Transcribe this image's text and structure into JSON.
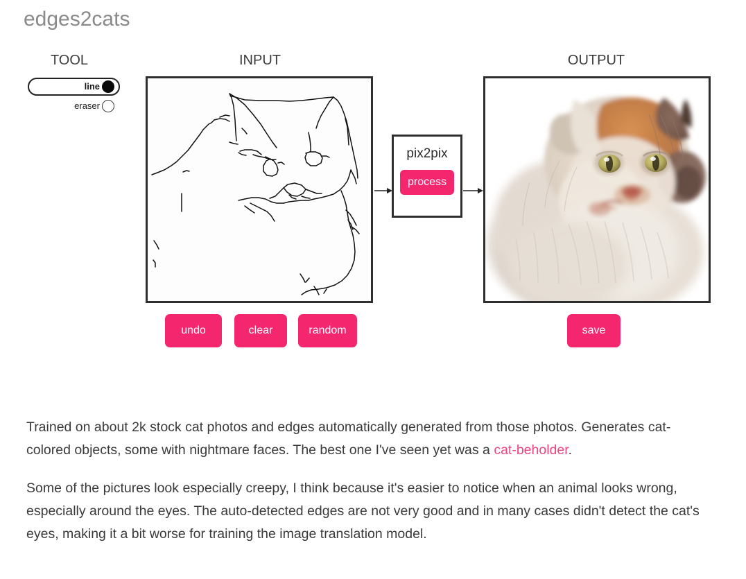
{
  "page": {
    "title": "edges2cats",
    "title_color": "#8a8a8a",
    "accent_color": "#f4266d",
    "link_color": "#f0447f"
  },
  "headers": {
    "tool": "TOOL",
    "input": "INPUT",
    "output": "OUTPUT"
  },
  "tool_panel": {
    "options": [
      {
        "label": "line",
        "selected": true
      },
      {
        "label": "eraser",
        "selected": false
      }
    ],
    "selected_value": "line"
  },
  "pix2pix": {
    "label": "pix2pix",
    "process_label": "process"
  },
  "input_panel": {
    "buttons": [
      {
        "id": "undo",
        "label": "undo"
      },
      {
        "id": "clear",
        "label": "clear"
      },
      {
        "id": "random",
        "label": "random"
      }
    ],
    "canvas_description": "hand-drawn black edge outline of a cat face on white background"
  },
  "output_panel": {
    "buttons": [
      {
        "id": "save",
        "label": "save"
      }
    ],
    "canvas_description": "generated fluffy cream and orange cat photo on white background"
  },
  "description": {
    "paragraph1_part1": "Trained on about 2k stock cat photos and edges automatically generated from those photos. Generates cat-colored objects, some with nightmare faces. The best one I've seen yet was a ",
    "paragraph1_link": "cat-beholder",
    "paragraph1_part2": ".",
    "paragraph2": "Some of the pictures look especially creepy, I think because it's easier to notice when an animal looks wrong, especially around the eyes. The auto-detected edges are not very good and in many cases didn't detect the cat's eyes, making it a bit worse for training the image translation model."
  }
}
